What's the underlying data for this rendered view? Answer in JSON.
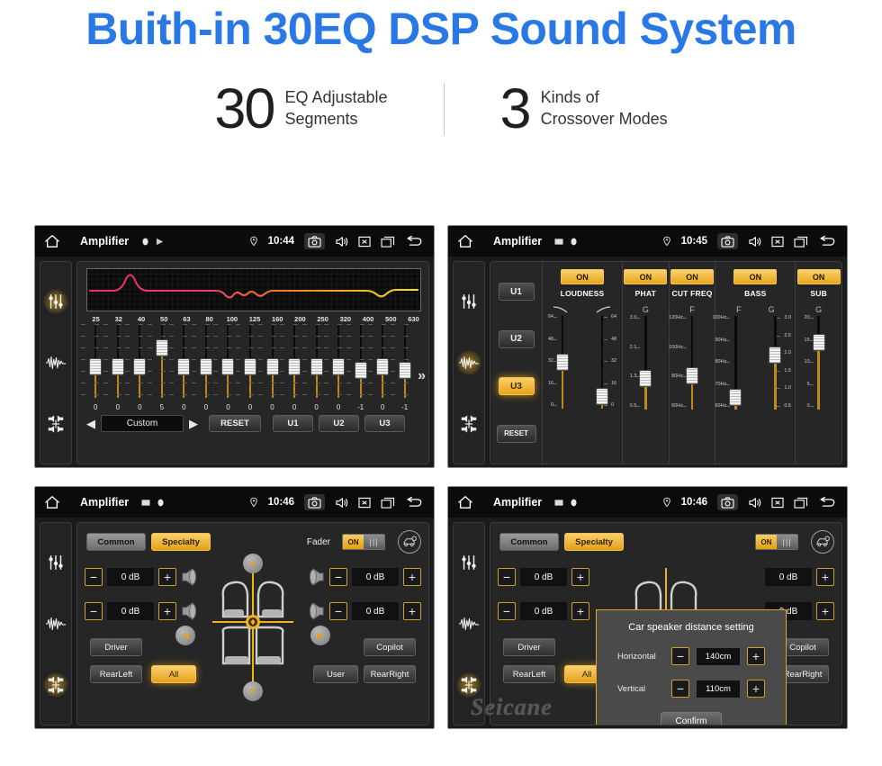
{
  "hero": {
    "title": "Buith-in 30EQ DSP Sound System",
    "stats": [
      {
        "number": "30",
        "line1": "EQ Adjustable",
        "line2": "Segments"
      },
      {
        "number": "3",
        "line1": "Kinds of",
        "line2": "Crossover Modes"
      }
    ]
  },
  "statusbar": {
    "title": "Amplifier",
    "times": [
      "10:44",
      "10:45",
      "10:46",
      "10:46"
    ],
    "icons": [
      "home-icon",
      "location-pin-icon",
      "camera-icon",
      "volume-icon",
      "close-icon",
      "recents-icon",
      "back-icon"
    ]
  },
  "rail": {
    "icons": [
      "equalizer-icon",
      "waveform-icon",
      "speaker-balance-icon"
    ]
  },
  "eq_screen": {
    "frequencies": [
      "25",
      "32",
      "40",
      "50",
      "63",
      "80",
      "100",
      "125",
      "160",
      "200",
      "250",
      "320",
      "400",
      "500",
      "630"
    ],
    "values": [
      "0",
      "0",
      "0",
      "5",
      "0",
      "0",
      "0",
      "0",
      "0",
      "0",
      "0",
      "0",
      "-1",
      "0",
      "-1"
    ],
    "preset": "Custom",
    "prev_label": "◀",
    "next_label": "▶",
    "reset_label": "RESET",
    "user_presets": [
      "U1",
      "U2",
      "U3"
    ],
    "more_label": "»"
  },
  "crossover_screen": {
    "user_buttons": [
      "U1",
      "U2",
      "U3"
    ],
    "active_user": "U3",
    "reset_label": "RESET",
    "columns": [
      {
        "name": "LOUDNESS",
        "state": "ON",
        "params": [
          "",
          ""
        ],
        "sliders": [
          {
            "ticks": [
              "64",
              "48",
              "32",
              "16",
              "0"
            ],
            "value": "32",
            "pos": 0.5
          },
          {
            "ticks": [
              "64",
              "48",
              "32",
              "16",
              "0"
            ],
            "value": "0",
            "pos": 0.05
          }
        ]
      },
      {
        "name": "PHAT",
        "state": "ON",
        "params": [
          "G"
        ],
        "sliders": [
          {
            "ticks": [
              "3.0",
              "2.1",
              "1.3",
              "0.5"
            ],
            "value": "1.3",
            "pos": 0.3
          }
        ]
      },
      {
        "name": "CUT FREQ",
        "state": "ON",
        "params": [
          "F"
        ],
        "sliders": [
          {
            "ticks": [
              "120Hz",
              "100Hz",
              "80Hz",
              "60Hz"
            ],
            "value": "80Hz",
            "pos": 0.33
          }
        ]
      },
      {
        "name": "BASS",
        "state": "ON",
        "params": [
          "F",
          "G"
        ],
        "sliders": [
          {
            "ticks": [
              "100Hz",
              "90Hz",
              "80Hz",
              "70Hz",
              "60Hz"
            ],
            "value": "60Hz",
            "pos": 0.05
          },
          {
            "ticks": [
              "3.0",
              "2.5",
              "2.0",
              "1.5",
              "1.0",
              "0.5"
            ],
            "value": "2.0",
            "pos": 0.6
          }
        ]
      },
      {
        "name": "SUB",
        "state": "ON",
        "params": [
          "G"
        ],
        "sliders": [
          {
            "ticks": [
              "20",
              "15",
              "10",
              "5",
              "0"
            ],
            "value": "15",
            "pos": 0.76
          }
        ]
      }
    ]
  },
  "fader_screen": {
    "tabs": [
      {
        "label": "Common",
        "active": false
      },
      {
        "label": "Specialty",
        "active": true
      }
    ],
    "fader_label": "Fader",
    "toggle_state": "ON",
    "gear_icon": "car-settings-icon",
    "db_values": [
      "0 dB",
      "0 dB",
      "0 dB",
      "0 dB"
    ],
    "minus_label": "−",
    "plus_label": "+",
    "position_buttons": [
      {
        "label": "Driver",
        "active": false
      },
      {
        "label": "Copilot",
        "active": false
      },
      {
        "label": "RearLeft",
        "active": false
      },
      {
        "label": "All",
        "active": true
      },
      {
        "label": "User",
        "active": false
      },
      {
        "label": "RearRight",
        "active": false
      }
    ]
  },
  "dialog": {
    "title": "Car speaker distance setting",
    "rows": [
      {
        "label": "Horizontal",
        "value": "140cm"
      },
      {
        "label": "Vertical",
        "value": "110cm"
      }
    ],
    "confirm_label": "Confirm",
    "minus_label": "−",
    "plus_label": "+"
  },
  "watermark": "Seicane",
  "colors": {
    "brand_blue": "#2878e6",
    "accent_amber": "#e8a317",
    "panel_dark": "#262626"
  }
}
